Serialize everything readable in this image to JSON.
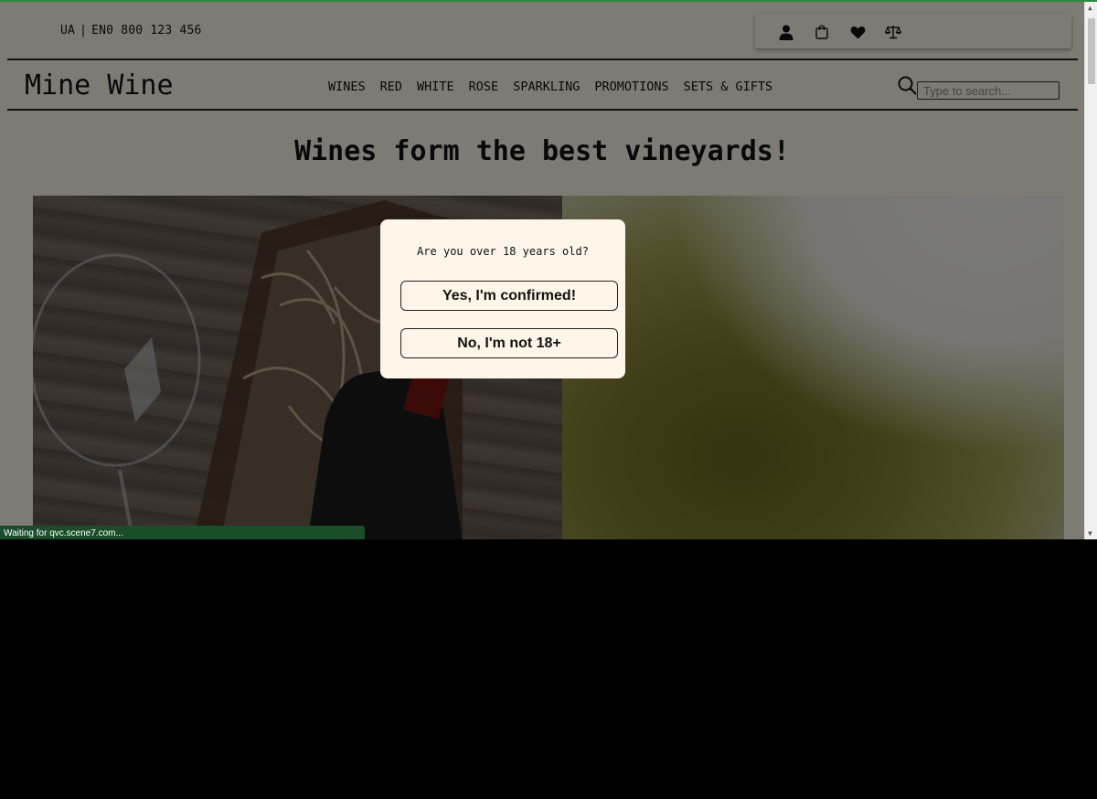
{
  "header": {
    "lang_ua": "UA",
    "lang_separator": "|",
    "lang_en": "EN",
    "phone": "0 800 123 456",
    "icons": [
      "user-icon",
      "shopping-bag-icon",
      "heart-icon",
      "scales-icon"
    ]
  },
  "nav": {
    "logo": "Mine Wine",
    "items": [
      "WINES",
      "RED",
      "WHITE",
      "ROSE",
      "SPARKLING",
      "PROMOTIONS",
      "SETS & GIFTS"
    ],
    "search_placeholder": "Type to search..."
  },
  "main": {
    "headline": "Wines form the best vineyards!"
  },
  "age_modal": {
    "question": "Are you over 18 years old?",
    "yes_label": "Yes, I'm confirmed!",
    "no_label": "No, I'm not 18+"
  },
  "browser": {
    "status_text": "Waiting for qvc.scene7.com..."
  },
  "colors": {
    "page_background": "#fdf6e8",
    "overlay": "rgba(0,0,0,0.5)",
    "status_bar": "#1b4d2a",
    "accent_line": "#2e8b3e"
  }
}
